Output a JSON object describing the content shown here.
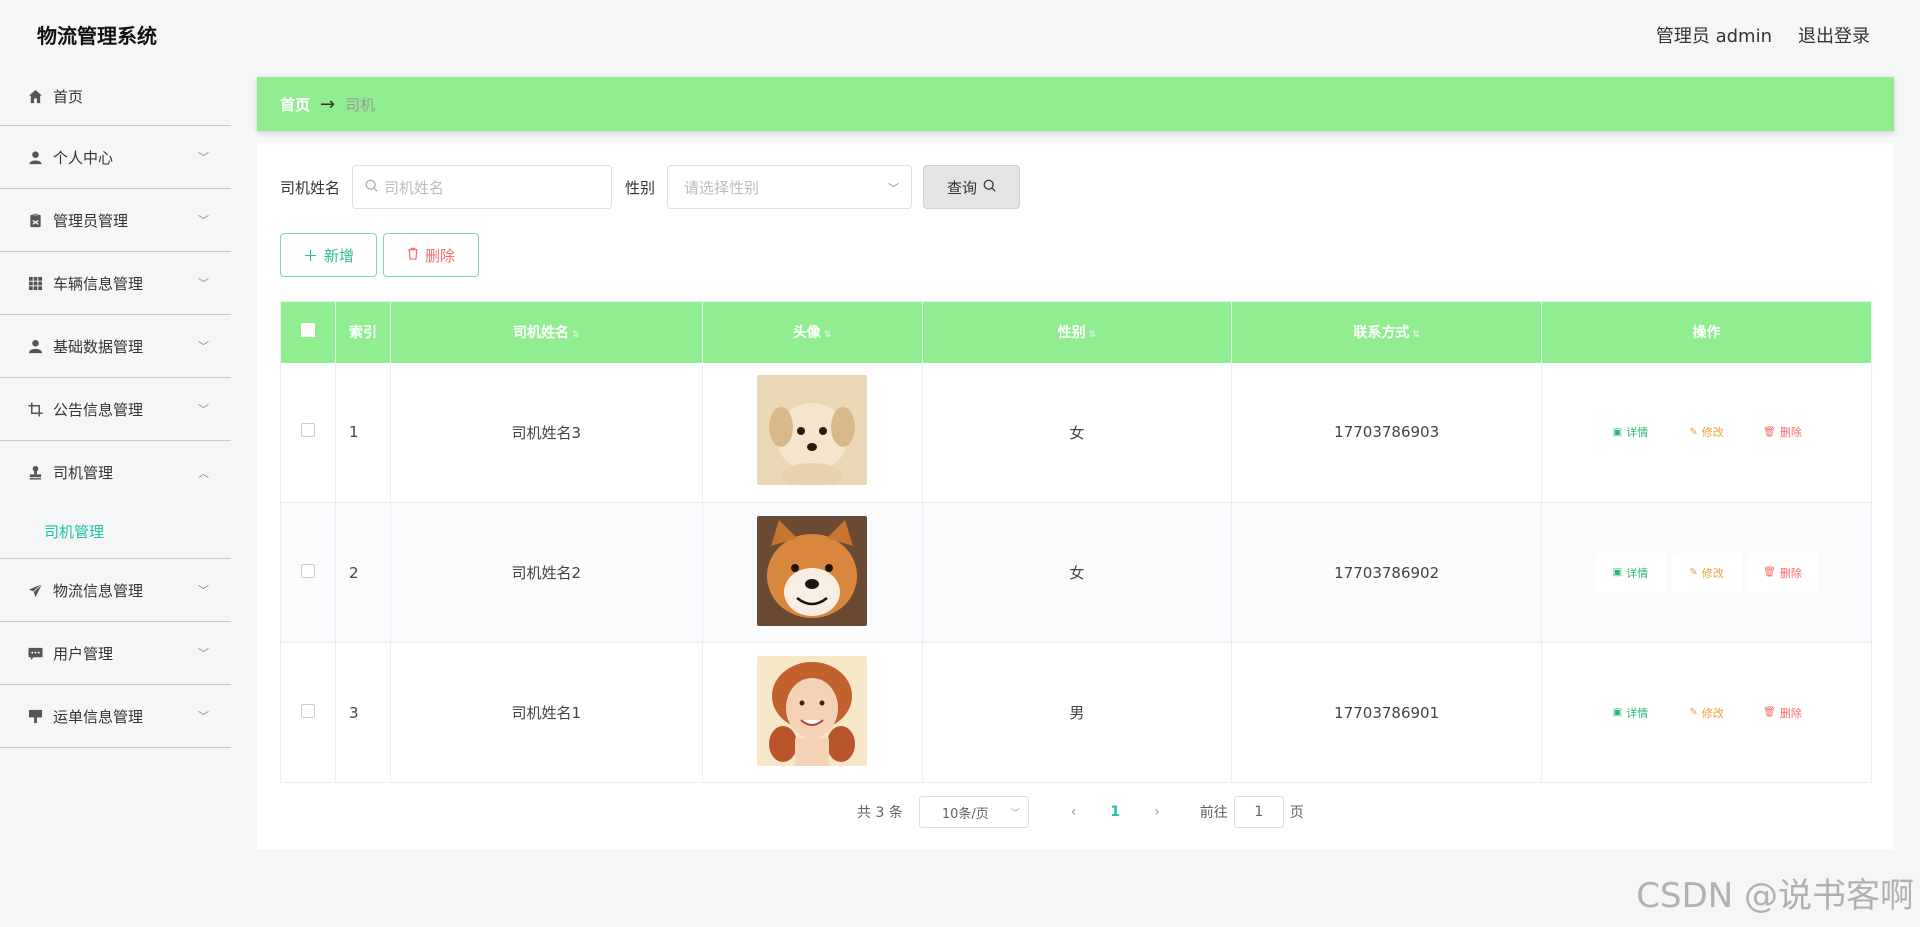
{
  "header": {
    "app_title": "物流管理系统",
    "admin_label": "管理员 admin",
    "logout_label": "退出登录"
  },
  "sidebar": {
    "items": [
      {
        "label": "首页",
        "icon": "home-icon"
      },
      {
        "label": "个人中心",
        "icon": "user-icon"
      },
      {
        "label": "管理员管理",
        "icon": "clipboard-icon"
      },
      {
        "label": "车辆信息管理",
        "icon": "grid-icon"
      },
      {
        "label": "基础数据管理",
        "icon": "person-icon"
      },
      {
        "label": "公告信息管理",
        "icon": "crop-icon"
      },
      {
        "label": "司机管理",
        "icon": "stamp-icon",
        "open": true,
        "sub": "司机管理"
      },
      {
        "label": "物流信息管理",
        "icon": "send-icon"
      },
      {
        "label": "用户管理",
        "icon": "chat-icon"
      },
      {
        "label": "运单信息管理",
        "icon": "easel-icon"
      }
    ]
  },
  "breadcrumb": {
    "home": "首页",
    "separator": "→",
    "current": "司机"
  },
  "search": {
    "name_label": "司机姓名",
    "name_placeholder": "司机姓名",
    "sex_label": "性别",
    "sex_placeholder": "请选择性别",
    "query_label": "查询"
  },
  "actions": {
    "add_label": "新增",
    "delete_label": "删除"
  },
  "table": {
    "headers": {
      "index": "索引",
      "name": "司机姓名",
      "avatar": "头像",
      "sex": "性别",
      "phone": "联系方式",
      "ops": "操作"
    },
    "rows": [
      {
        "index": "1",
        "name": "司机姓名3",
        "sex": "女",
        "phone": "17703786903",
        "avatar": "puppy-photo"
      },
      {
        "index": "2",
        "name": "司机姓名2",
        "sex": "女",
        "phone": "17703786902",
        "avatar": "shiba-photo"
      },
      {
        "index": "3",
        "name": "司机姓名1",
        "sex": "男",
        "phone": "17703786901",
        "avatar": "woman-photo"
      }
    ],
    "op_labels": {
      "detail": "详情",
      "edit": "修改",
      "remove": "删除"
    }
  },
  "pagination": {
    "total": "共 3 条",
    "page_size": "10条/页",
    "current_page": "1",
    "goto_prefix": "前往",
    "goto_value": "1",
    "goto_suffix": "页"
  },
  "watermark": "CSDN @说书客啊",
  "colors": {
    "accent_green": "#90ee90",
    "teal": "#1ec2a4",
    "danger": "#f56c6c",
    "warning": "#e6a23c",
    "success": "#2bb673"
  }
}
